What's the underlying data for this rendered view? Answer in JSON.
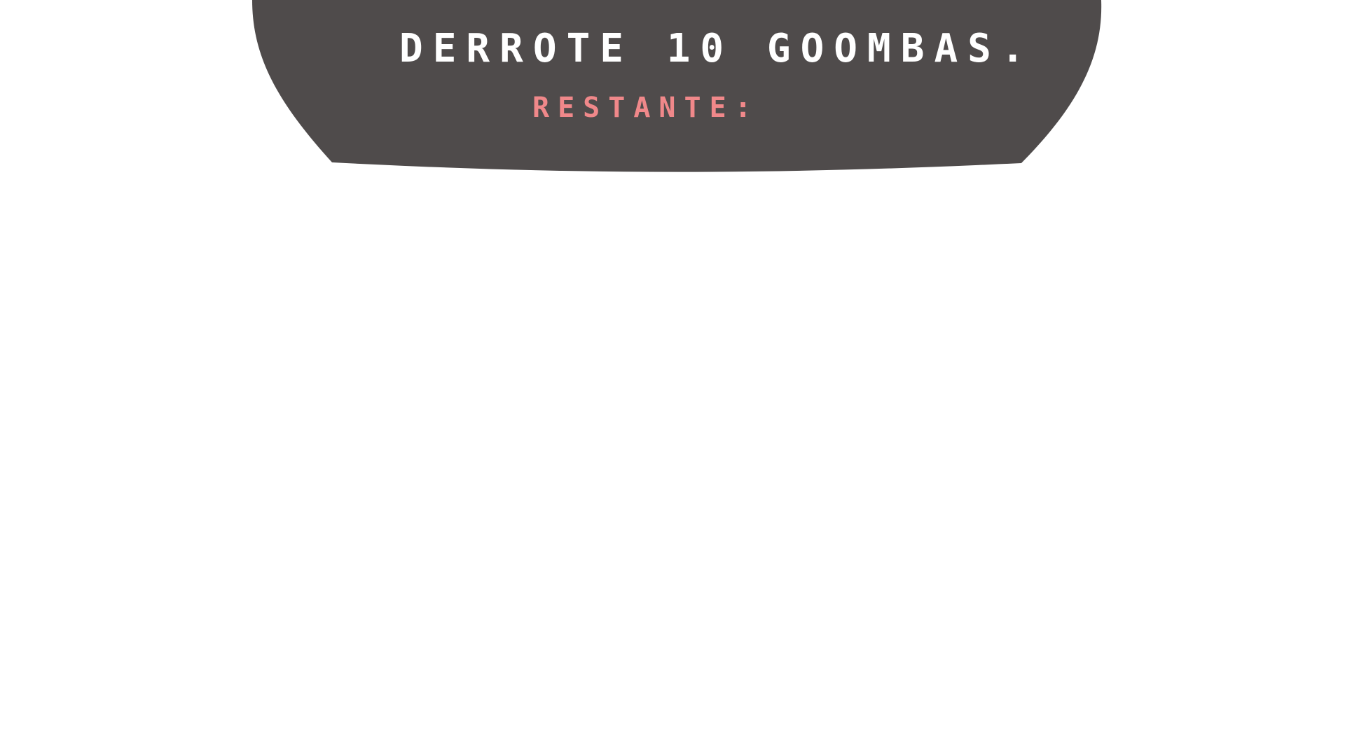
{
  "mission": {
    "objective_text": "DERROTE 10 GOOMBAS.",
    "remaining_label": "RESTANTE:",
    "remaining_count": ""
  },
  "colors": {
    "banner_background": "#4f4b4b",
    "objective_text": "#ffffff",
    "remaining_text": "#f0888a",
    "page_background": "#ffffff"
  }
}
